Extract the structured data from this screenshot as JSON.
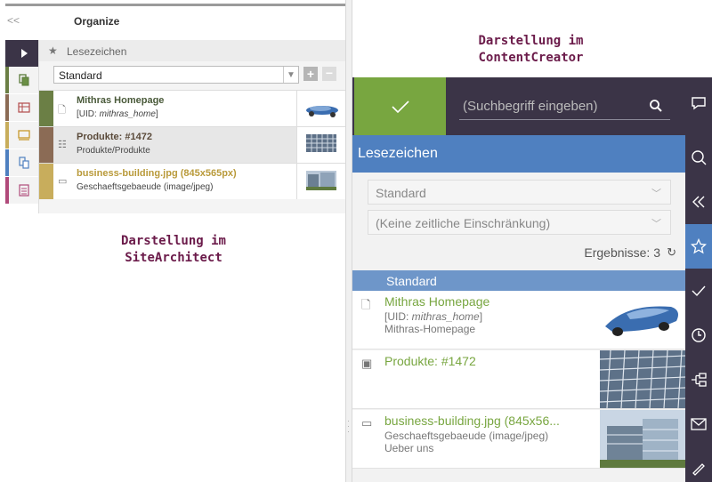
{
  "site_architect": {
    "collapse": "<<",
    "title": "Organize",
    "bookmarks_header": "Lesezeichen",
    "select_value": "Standard",
    "plus_label": "+",
    "minus_label": "−",
    "rows": [
      {
        "title": "Mithras Homepage",
        "sub_prefix": "[UID: ",
        "sub_italic": "mithras_home",
        "sub_suffix": "]",
        "title_color": "#4a5a3a",
        "accent": "#6b7f45",
        "highlight": false
      },
      {
        "title": "Produkte: #1472",
        "sub_prefix": "Produkte/Produkte",
        "sub_italic": "",
        "sub_suffix": "",
        "title_color": "#5a4a3a",
        "accent": "#8b6b55",
        "highlight": true
      },
      {
        "title": "business-building.jpg (845x565px)",
        "sub_prefix": "Geschaeftsgebaeude (image/jpeg)",
        "sub_italic": "",
        "sub_suffix": "",
        "title_color": "#b99a3a",
        "accent": "#c8ad5c",
        "highlight": false
      }
    ],
    "caption_line1": "Darstellung im",
    "caption_line2": "SiteArchitect"
  },
  "content_creator": {
    "caption_line1": "Darstellung im",
    "caption_line2": "ContentCreator",
    "search_placeholder": "(Suchbegriff eingeben)",
    "panel_title": "Lesezeichen",
    "select1": "Standard",
    "select2": "(Keine zeitliche Einschränkung)",
    "results": "Ergebnisse: 3",
    "group": "Standard",
    "items": [
      {
        "title": "Mithras Homepage",
        "line2_prefix": "[UID: ",
        "line2_italic": "mithras_home",
        "line2_suffix": "]",
        "line3": "Mithras-Homepage"
      },
      {
        "title": "Produkte: #1472",
        "line2_prefix": "",
        "line2_italic": "",
        "line2_suffix": "",
        "line3": ""
      },
      {
        "title": "business-building.jpg (845x56...",
        "line2_prefix": "Geschaeftsgebaeude (image/jpeg)",
        "line2_italic": "",
        "line2_suffix": "",
        "line3": "Ueber uns"
      }
    ]
  },
  "colors": {
    "dark": "#3b3447",
    "green": "#78a640",
    "blue": "#4f80c0",
    "group_blue": "#6e96c9",
    "caption": "#6b1b4a"
  }
}
